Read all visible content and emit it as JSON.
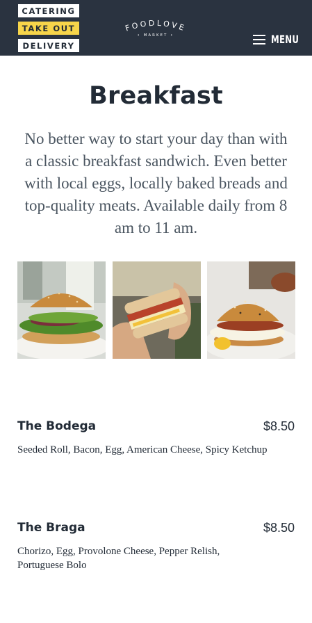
{
  "nav": {
    "catering": "CATERING",
    "take_out": "TAKE OUT",
    "delivery": "DELIVERY"
  },
  "logo": {
    "name": "FOODLOVE",
    "sub": "MARKET"
  },
  "menu": {
    "label": "MENU",
    "icon": "hamburger-icon"
  },
  "page": {
    "title": "Breakfast",
    "intro": "No better way to start your day than with a classic breakfast sandwich. Even better with local eggs, locally baked breads and top-quality meats. Available daily from 8 am to 11 am."
  },
  "items": [
    {
      "name": "The Bodega",
      "price": "$8.50",
      "description": "Seeded Roll, Bacon, Egg, American Cheese, Spicy Ketchup"
    },
    {
      "name": "The Braga",
      "price": "$8.50",
      "description": "Chorizo, Egg, Provolone Cheese, Pepper Relish, Portuguese Bolo"
    }
  ],
  "colors": {
    "header_bg": "#2a3340",
    "accent_yellow": "#f7d54a",
    "text_dark": "#222b36",
    "text_muted": "#4a5560"
  }
}
